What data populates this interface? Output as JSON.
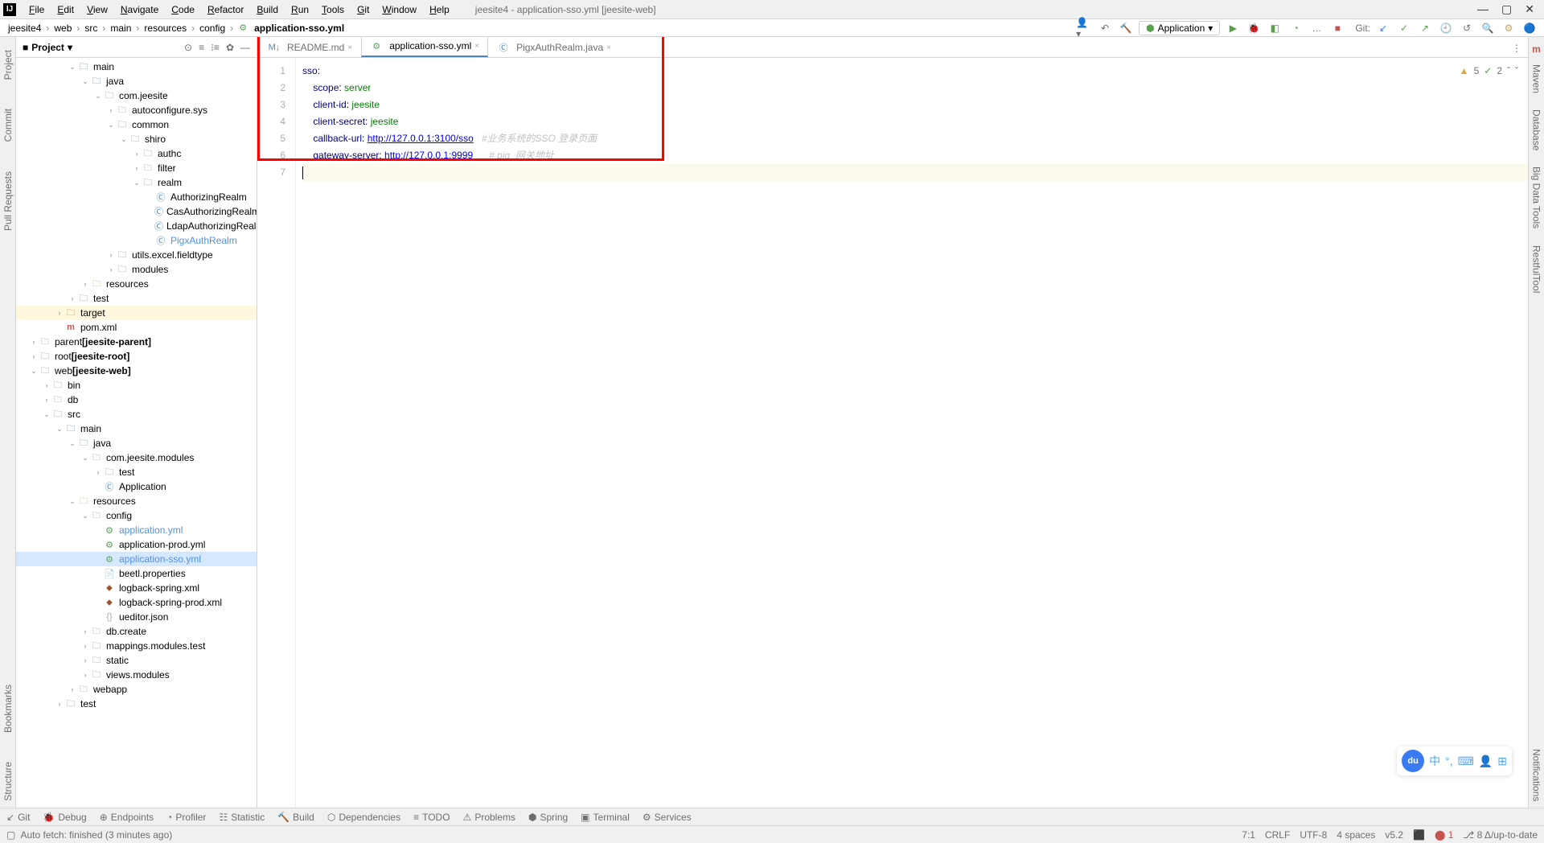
{
  "window": {
    "title": "jeesite4 - application-sso.yml [jeesite-web]",
    "menu": [
      "File",
      "Edit",
      "View",
      "Navigate",
      "Code",
      "Refactor",
      "Build",
      "Run",
      "Tools",
      "Git",
      "Window",
      "Help"
    ]
  },
  "breadcrumb": [
    "jeesite4",
    "web",
    "src",
    "main",
    "resources",
    "config",
    "application-sso.yml"
  ],
  "run_config": "Application",
  "git_label": "Git:",
  "project": {
    "title": "Project"
  },
  "tree": {
    "main": "main",
    "java": "java",
    "com_jeesite": "com.jeesite",
    "autoconfigure_sys": "autoconfigure.sys",
    "common": "common",
    "shiro": "shiro",
    "authc": "authc",
    "filter": "filter",
    "realm": "realm",
    "AuthorizingRealm": "AuthorizingRealm",
    "CasAuthorizingRealm": "CasAuthorizingRealm",
    "LdapAuthorizingRealm": "LdapAuthorizingRealm",
    "PigxAuthRealm": "PigxAuthRealm",
    "utils_excel": "utils.excel.fieldtype",
    "modules": "modules",
    "resources": "resources",
    "test": "test",
    "target": "target",
    "pom_xml": "pom.xml",
    "parent": "parent ",
    "parent_mod": "[jeesite-parent]",
    "root": "root ",
    "root_mod": "[jeesite-root]",
    "web": "web ",
    "web_mod": "[jeesite-web]",
    "bin": "bin",
    "db": "db",
    "src": "src",
    "com_jeesite_modules": "com.jeesite.modules",
    "test2": "test",
    "Application": "Application",
    "config": "config",
    "application_yml": "application.yml",
    "application_prod_yml": "application-prod.yml",
    "application_sso_yml": "application-sso.yml",
    "beetl_properties": "beetl.properties",
    "logback_spring_xml": "logback-spring.xml",
    "logback_spring_prod_xml": "logback-spring-prod.xml",
    "ueditor_json": "ueditor.json",
    "db_create": "db.create",
    "mappings_modules_test": "mappings.modules.test",
    "static": "static",
    "views_modules": "views.modules",
    "webapp": "webapp",
    "test3": "test"
  },
  "editor_tabs": [
    {
      "name": "README.md",
      "icon": "md"
    },
    {
      "name": "application-sso.yml",
      "icon": "yaml",
      "active": true
    },
    {
      "name": "PigxAuthRealm.java",
      "icon": "java"
    }
  ],
  "code": {
    "l1_key": "sso",
    "l1_colon": ":",
    "l2_key": "scope",
    "l2_val": "server",
    "l3_key": "client-id",
    "l3_val": "jeesite",
    "l4_key": "client-secret",
    "l4_val": "jeesite",
    "l5_key": "callback-url",
    "l5_val": "http://127.0.0.1:3100/sso",
    "l5_comment": "#业务系统的SSO 登录页面",
    "l6_key": "gateway-server",
    "l6_val": "http://127.0.0.1:9999",
    "l6_comment": "# pig  网关地址",
    "line_numbers": [
      "1",
      "2",
      "3",
      "4",
      "5",
      "6",
      "7"
    ]
  },
  "inspection": {
    "warn": "5",
    "typo": "2"
  },
  "right_tabs": [
    "Maven",
    "Database",
    "Big Data Tools",
    "RestfulTool",
    "Notifications"
  ],
  "left_tabs": [
    "Project",
    "Commit",
    "Pull Requests",
    "Bookmarks",
    "Structure"
  ],
  "bottom_tools": [
    "Git",
    "Debug",
    "Endpoints",
    "Profiler",
    "Statistic",
    "Build",
    "Dependencies",
    "TODO",
    "Problems",
    "Spring",
    "Terminal",
    "Services"
  ],
  "status": {
    "left": "Auto fetch: finished (3 minutes ago)",
    "pos": "7:1",
    "crlf": "CRLF",
    "enc": "UTF-8",
    "indent": "4 spaces",
    "ver": "v5.2",
    "branch": "8 Δ/up-to-date"
  }
}
